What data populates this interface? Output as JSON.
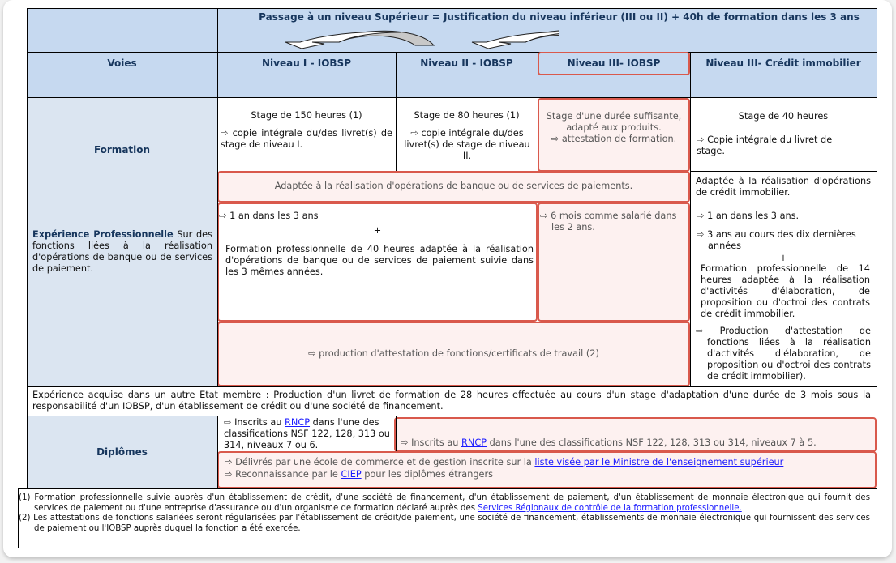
{
  "banner": {
    "text": "Passage à un niveau Supérieur = Justification du niveau inférieur (III ou II) + 40h de formation dans les 3 ans"
  },
  "columns": {
    "voies": "Voies",
    "niveau1": "Niveau I - IOBSP",
    "niveau2": "Niveau II - IOBSP",
    "niveau3": "Niveau III- IOBSP",
    "niveau3ci": "Niveau III- Crédit immobilier"
  },
  "icons": {
    "arrow_bullet": "⇨"
  },
  "formation": {
    "label": "Formation",
    "n1_title": "Stage de 150 heures (1)",
    "n1_detail": "copie intégrale du/des livret(s) de stage de niveau I.",
    "n2_title": "Stage de 80 heures (1)",
    "n2_detail": "copie intégrale du/des livret(s) de stage de niveau II.",
    "n3_line1": "Stage d'une durée suffisante, adapté aux produits.",
    "n3_line2": "attestation de formation.",
    "ci_title": "Stage de 40 heures",
    "ci_detail": "Copie intégrale du livret de stage.",
    "shared_banque": "Adaptée à la réalisation d'opérations de banque ou de services de paiements.",
    "ci_adapted": "Adaptée à la réalisation d'opérations de crédit immobilier."
  },
  "experience": {
    "label_bold": "Expérience Professionnelle",
    "label_rest": " Sur des fonctions liées à la réalisation d'opérations de banque ou de services de paiement.",
    "n12_line1": "1 an dans les 3 ans",
    "n12_plus": "+",
    "n12_line2": "Formation professionnelle de 40 heures adaptée à la réalisation d'opérations de banque ou de services de paiement suivie dans les 3 mêmes années.",
    "n3": "6 mois comme salarié dans les 2 ans.",
    "ci_line1": "1 an dans les 3 ans.",
    "ci_line2": "3 ans au cours des dix dernières années",
    "ci_plus": "+",
    "ci_line3": "Formation professionnelle de 14 heures adaptée à la réalisation d'activités d'élaboration, de proposition ou d'octroi des contrats de crédit immobilier.",
    "shared_attestation": "production d'attestation de fonctions/certificats de travail (2)",
    "ci_attestation": "Production d'attestation de fonctions liées à la réalisation d'activités d'élaboration, de proposition ou d'octroi des contrats de crédit immobilier)."
  },
  "autre_etat": {
    "label": "Expérience acquise dans un autre Etat membre",
    "text": " : Production d'un livret de formation de 28 heures effectuée au cours d'un stage d'adaptation d'une durée de 3 mois sous la responsabilité d'un IOBSP, d'un établissement de crédit ou d'une société de financement."
  },
  "diplomes": {
    "label": "Diplômes",
    "n1_pre": "Inscrits au ",
    "n1_link": "RNCP",
    "n1_post": " dans l'une des classifications NSF 122, 128, 313 ou 314, niveaux 7 ou 6.",
    "rest_pre": "Inscrits au ",
    "rest_link": "RNCP",
    "rest_post": " dans l'une des classifications NSF 122, 128, 313 ou 314, niveaux 7 à 5.",
    "ecole_pre": "Délivrés par une école de commerce et de gestion inscrite sur la ",
    "ecole_link": "liste visée par le Ministre de l'enseignement supérieur",
    "ciep_pre": "Reconnaissance par le ",
    "ciep_link": "CIEP",
    "ciep_post": " pour les diplômes étrangers"
  },
  "footnotes": {
    "fn1_num": "(1)",
    "fn1_text": "Formation professionnelle suivie auprès d'un établissement de crédit, d'une société de financement, d'un établissement de paiement, d'un établissement de monnaie électronique qui fournit des services de paiement ou d'une entreprise d'assurance ou d'un organisme de formation déclaré auprès des ",
    "fn1_link": "Services Régionaux de contrôle de la formation professionnelle.",
    "fn2_num": "(2)",
    "fn2_text": "Les attestations de fonctions salariées seront régularisées par l'établissement de crédit/de paiement, une société de financement, établissements de monnaie électronique qui fournissent des services de paiement ou l'IOBSP auprès duquel la fonction a été exercée."
  }
}
